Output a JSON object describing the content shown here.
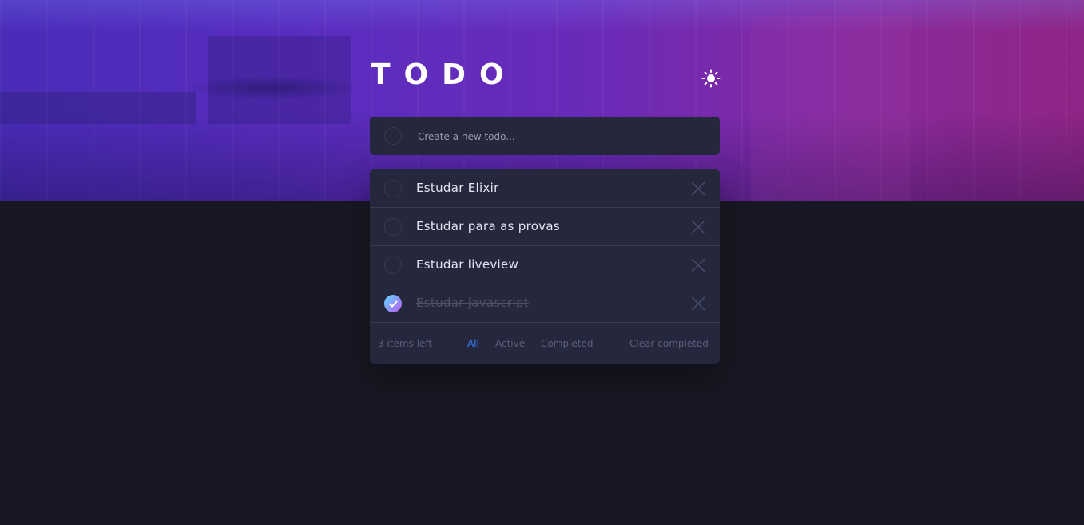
{
  "app": {
    "title": "TODO",
    "theme_toggle_icon": "sun-icon"
  },
  "new_todo": {
    "placeholder": "Create a new todo...",
    "value": ""
  },
  "todos": [
    {
      "text": "Estudar Elixir",
      "completed": false
    },
    {
      "text": "Estudar para as provas",
      "completed": false
    },
    {
      "text": "Estudar liveview",
      "completed": false
    },
    {
      "text": "Estudar javascript",
      "completed": true
    }
  ],
  "footer": {
    "items_left": "3 items left",
    "filters": [
      "All",
      "Active",
      "Completed"
    ],
    "active_filter": "All",
    "clear_completed": "Clear completed"
  },
  "colors": {
    "background": "#181824",
    "card": "#25273c",
    "accent": "#3a7cfd",
    "check_gradient_start": "#57ddff",
    "check_gradient_end": "#c058f3"
  }
}
